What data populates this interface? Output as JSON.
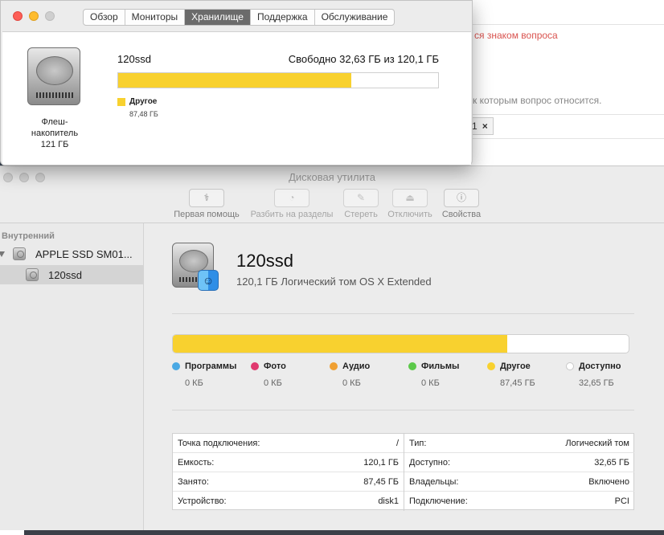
{
  "background_page": {
    "question_hint": "ся знаком вопроса",
    "tags_hint": "к которым вопрос относится.",
    "tag_chip": "1",
    "tag_close": "×"
  },
  "about_window": {
    "tabs": [
      "Обзор",
      "Мониторы",
      "Хранилище",
      "Поддержка",
      "Обслуживание"
    ],
    "active_tab": "Хранилище",
    "device_label_line1": "Флеш-",
    "device_label_line2": "накопитель",
    "device_label_line3": "121 ГБ",
    "volume_name": "120ssd",
    "free_text": "Свободно 32,63 ГБ из 120,1 ГБ",
    "used_fraction": 0.728,
    "legend_name": "Другое",
    "legend_value": "87,48 ГБ"
  },
  "disk_utility": {
    "title": "Дисковая утилита",
    "toolbar": {
      "first_aid": "Первая помощь",
      "partition": "Разбить на разделы",
      "erase": "Стереть",
      "unmount": "Отключить",
      "info": "Свойства"
    },
    "sidebar": {
      "section": "Внутренний",
      "drive": "APPLE SSD SM01...",
      "volume": "120ssd"
    },
    "volume": {
      "name": "120ssd",
      "subtitle": "120,1 ГБ Логический том OS X Extended",
      "used_fraction": 0.734
    },
    "legend": [
      {
        "name": "Программы",
        "value": "0 КБ",
        "color": "#4aa9e4"
      },
      {
        "name": "Фото",
        "value": "0 КБ",
        "color": "#e0396f"
      },
      {
        "name": "Аудио",
        "value": "0 КБ",
        "color": "#f0a032"
      },
      {
        "name": "Фильмы",
        "value": "0 КБ",
        "color": "#5cc94a"
      },
      {
        "name": "Другое",
        "value": "87,45 ГБ",
        "color": "#f8d12f"
      },
      {
        "name": "Доступно",
        "value": "32,65 ГБ",
        "color": "#ffffff"
      }
    ],
    "info_left": [
      {
        "label": "Точка подключения:",
        "value": "/"
      },
      {
        "label": "Емкость:",
        "value": "120,1 ГБ"
      },
      {
        "label": "Занято:",
        "value": "87,45 ГБ"
      },
      {
        "label": "Устройство:",
        "value": "disk1"
      }
    ],
    "info_right": [
      {
        "label": "Тип:",
        "value": "Логический том"
      },
      {
        "label": "Доступно:",
        "value": "32,65 ГБ"
      },
      {
        "label": "Владельцы:",
        "value": "Включено"
      },
      {
        "label": "Подключение:",
        "value": "PCI"
      }
    ]
  }
}
